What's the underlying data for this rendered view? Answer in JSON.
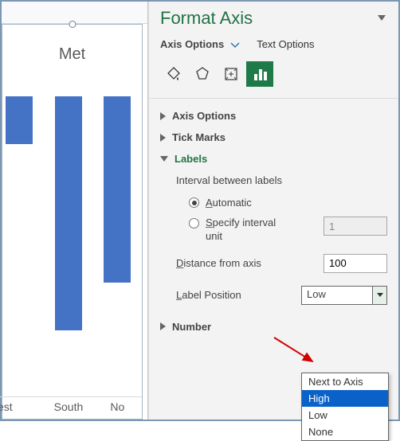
{
  "chart_data": {
    "type": "bar",
    "title": "Met",
    "categories": [
      "est",
      "South",
      "No"
    ],
    "values": [
      16,
      78,
      62
    ],
    "ylim": [
      0,
      100
    ]
  },
  "panel": {
    "title": "Format Axis",
    "tabs": {
      "axis_options": "Axis Options",
      "text_options": "Text Options"
    },
    "sections": {
      "axis_options": "Axis Options",
      "tick_marks": "Tick Marks",
      "labels": "Labels",
      "number": "Number"
    },
    "labels": {
      "interval_header": "Interval between labels",
      "automatic": "Automatic",
      "specify_prefix": "S",
      "specify_rest": "pecify interval unit",
      "specify_value": "1",
      "distance_prefix": "D",
      "distance_rest": "istance from axis",
      "distance_value": "100",
      "position_prefix": "L",
      "position_rest": "abel Position",
      "position_value": "Low",
      "position_options": [
        "Next to Axis",
        "High",
        "Low",
        "None"
      ],
      "position_highlight": "High"
    }
  }
}
